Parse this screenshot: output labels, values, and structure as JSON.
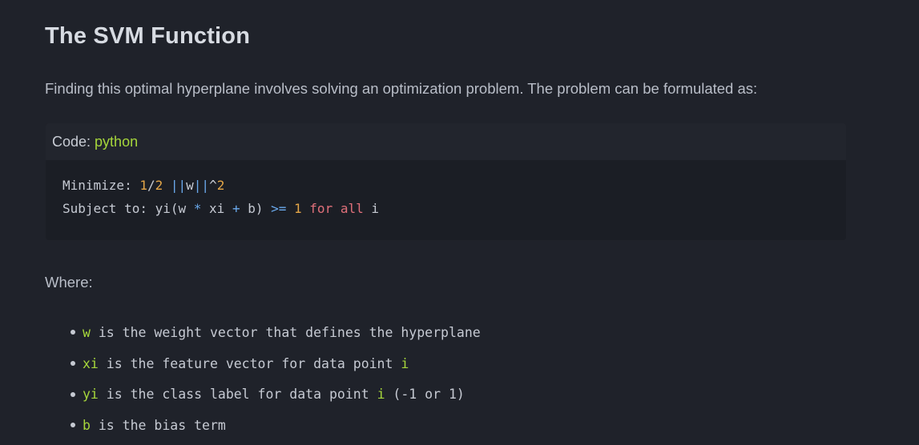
{
  "heading": "The SVM Function",
  "intro": "Finding this optimal hyperplane involves solving an optimization problem. The problem can be formulated as:",
  "code_block": {
    "header_label": "Code:",
    "language": "python",
    "line1": {
      "t1": "Minimize: ",
      "n1": "1",
      "t2": "/",
      "n2": "2",
      "t3": " ",
      "op1": "||",
      "t4": "w",
      "op2": "||",
      "t5": "^",
      "n3": "2"
    },
    "line2": {
      "t1": "Subject to: yi(w ",
      "op1": "*",
      "t2": " xi ",
      "op2": "+",
      "t3": " b) ",
      "op3": ">=",
      "t4": " ",
      "n1": "1",
      "t5": " ",
      "kw1": "for",
      "t6": " ",
      "kw2": "all",
      "t7": " i"
    }
  },
  "where_label": "Where:",
  "definitions": [
    {
      "term": "w",
      "text": " is the weight vector that defines the hyperplane",
      "term2": "",
      "tail": ""
    },
    {
      "term": "xi",
      "text": " is the feature vector for data point ",
      "term2": "i",
      "tail": ""
    },
    {
      "term": "yi",
      "text": " is the class label for data point ",
      "term2": "i",
      "tail": " (-1 or 1)"
    },
    {
      "term": "b",
      "text": " is the bias term",
      "term2": "",
      "tail": ""
    }
  ],
  "colors": {
    "background": "#1f222a",
    "code_background": "#1b1e25",
    "code_header_background": "#22252d",
    "language_accent": "#a6d63b",
    "number": "#e5a748",
    "keyword": "#e0707a",
    "operator": "#6aa9ec"
  }
}
